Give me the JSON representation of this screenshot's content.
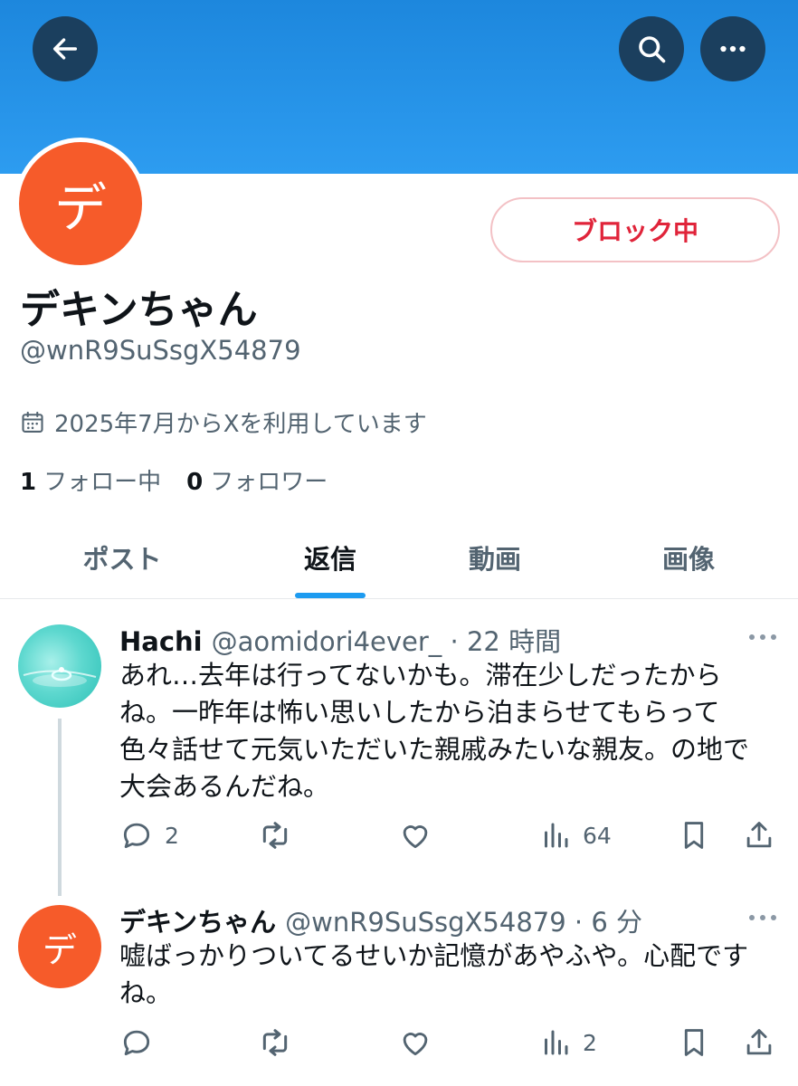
{
  "profile": {
    "avatar_initial": "デ",
    "block_label": "ブロック中",
    "display_name": "デキンちゃん",
    "handle": "@wnR9SuSsgX54879",
    "joined": "2025年7月からXを利用しています",
    "following_count": "1",
    "following_label": "フォロー中",
    "followers_count": "0",
    "followers_label": "フォロワー"
  },
  "tabs": [
    {
      "label": "ポスト"
    },
    {
      "label": "返信"
    },
    {
      "label": "動画"
    },
    {
      "label": "画像"
    }
  ],
  "posts": [
    {
      "name": "Hachi",
      "meta": "@aomidori4ever_ · 22 時間",
      "lines": [
        "あれ…去年は行ってないかも。滞在少しだったから",
        "ね。一昨年は怖い思いしたから泊まらせてもらって",
        "色々話せて元気いただいた親戚みたいな親友。の地で",
        "大会あるんだね。"
      ],
      "replies": "2",
      "views": "64"
    },
    {
      "name": "デキンちゃん",
      "meta": "@wnR9SuSsgX54879 · 6 分",
      "avatar_initial": "デ",
      "lines": [
        "嘘ばっかりついてるせいか記憶があやふや。心配です",
        "ね。"
      ],
      "replies": "",
      "views": "2"
    }
  ],
  "colors": {
    "banner": "#2d9cf0",
    "icon_button_bg": "#1b3f5e",
    "avatar": "#f65b2a",
    "block_text": "#e0243a",
    "accent": "#1d9bf0",
    "muted": "#536471"
  },
  "icons": [
    "back-arrow-icon",
    "search-icon",
    "more-icon",
    "calendar-icon",
    "reply-icon",
    "repost-icon",
    "like-icon",
    "views-icon",
    "bookmark-icon",
    "share-icon"
  ]
}
